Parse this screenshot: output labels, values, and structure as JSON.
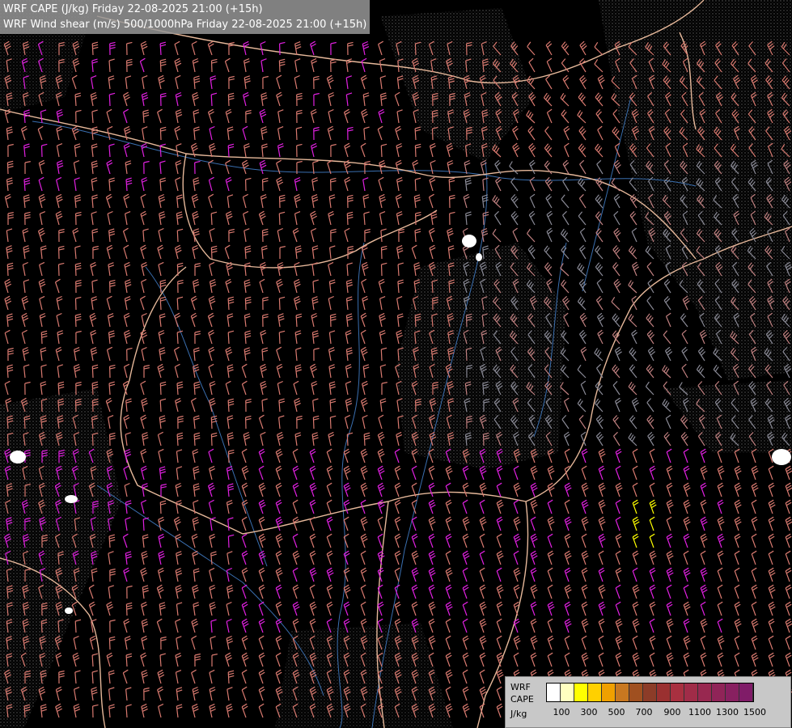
{
  "title": {
    "line1": "WRF CAPE (J/kg) Friday 22-08-2025 21:00 (+15h)",
    "line2": "WRF Wind shear (m/s) 500/1000hPa Friday 22-08-2025 21:00 (+15h)"
  },
  "legend": {
    "line1": "WRF",
    "line2": "CAPE",
    "line3": "J/kg",
    "ticks": [
      "100",
      "300",
      "500",
      "700",
      "900",
      "1100",
      "1300",
      "1500"
    ],
    "colors": [
      "#ffffff",
      "#ffffc0",
      "#ffff00",
      "#ffd000",
      "#f0a000",
      "#c87820",
      "#a05020",
      "#8c3c28",
      "#9a3030",
      "#a83040",
      "#a02c48",
      "#982850",
      "#902458",
      "#882060",
      "#801c68"
    ]
  },
  "map": {
    "background": "#000000",
    "border_color": "#e6b89a",
    "river_color": "#3a6fb0",
    "barb_colors": {
      "low": "#d97a70",
      "mid": "#c08080",
      "high": "#e020e0",
      "peak": "#ffff00"
    }
  }
}
